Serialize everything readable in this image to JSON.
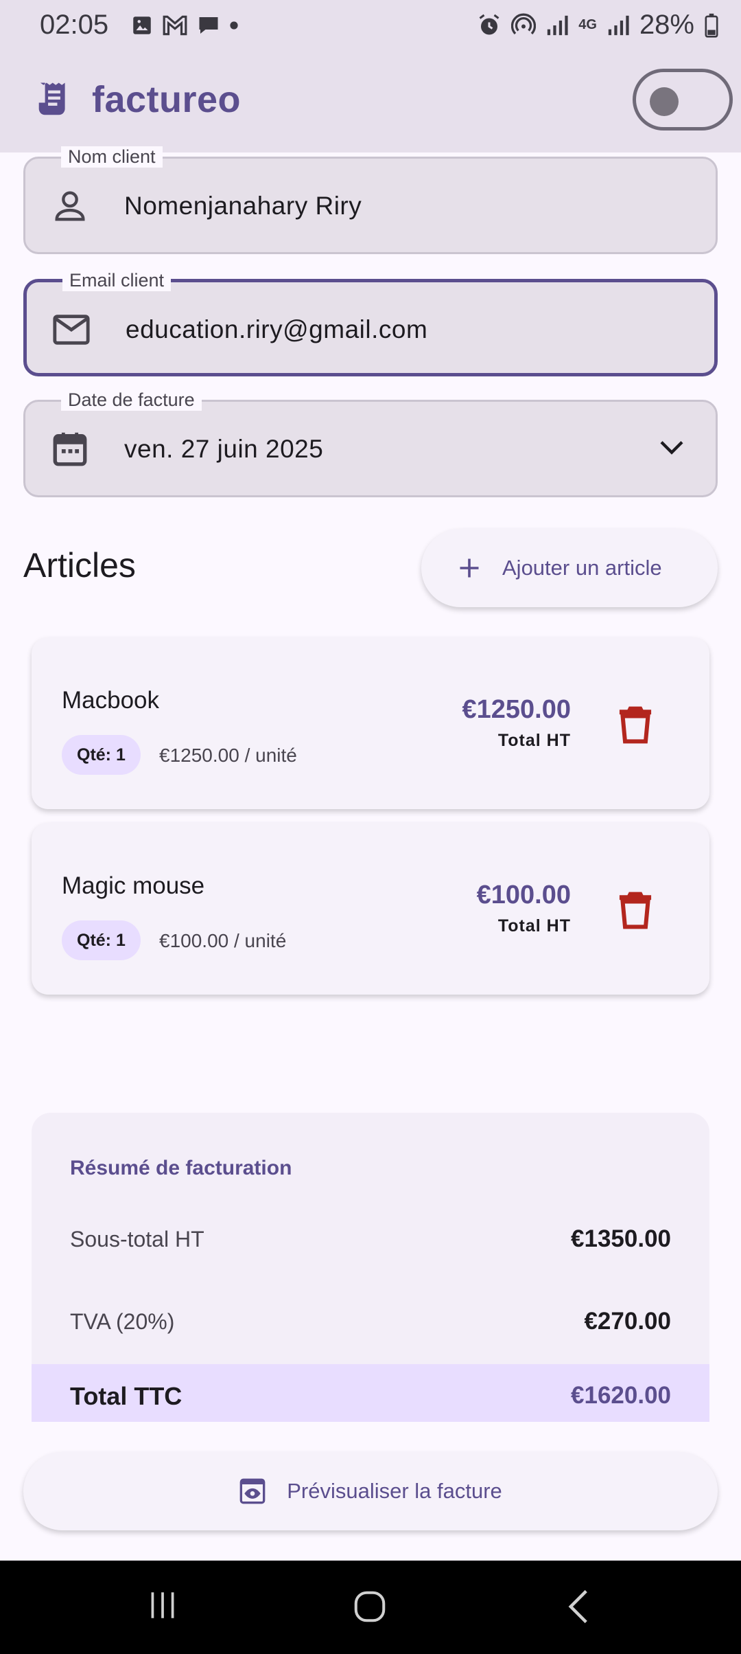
{
  "status_bar": {
    "time": "02:05",
    "battery": "28%",
    "network": "4G"
  },
  "app_bar": {
    "title": "factureo",
    "theme_toggle_on": false
  },
  "form": {
    "client_name": {
      "label": "Nom client",
      "value": "Nomenjanahary Riry",
      "icon": "person-icon"
    },
    "client_email": {
      "label": "Email client",
      "value": "education.riry@gmail.com",
      "icon": "mail-icon"
    },
    "invoice_date": {
      "label": "Date de facture",
      "value": "ven. 27 juin 2025",
      "icon": "calendar-icon"
    }
  },
  "articles": {
    "title": "Articles",
    "add_label": "Ajouter un article",
    "items": [
      {
        "name": "Macbook",
        "qty": "Qté: 1",
        "unit_price": "€1250.00 / unité",
        "total": "€1250.00",
        "total_label": "Total HT"
      },
      {
        "name": "Magic mouse",
        "qty": "Qté: 1",
        "unit_price": "€100.00 / unité",
        "total": "€100.00",
        "total_label": "Total HT"
      }
    ]
  },
  "summary": {
    "title": "Résumé de facturation",
    "subtotal_label": "Sous-total HT",
    "subtotal_value": "€1350.00",
    "vat_label": "TVA (20%)",
    "vat_value": "€270.00",
    "total_label": "Total TTC",
    "total_value": "€1620.00"
  },
  "preview_label": "Prévisualiser la facture",
  "colors": {
    "primary": "#5b4e8e",
    "danger": "#b3261e",
    "surface": "#fcf8ff",
    "app_bar": "#e7e0ec"
  }
}
